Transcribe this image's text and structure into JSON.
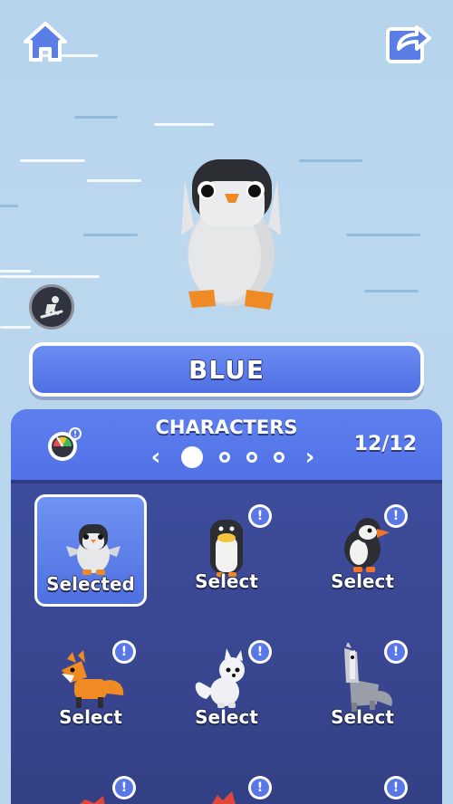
{
  "character_name": "BLUE",
  "panel": {
    "title": "CHARACTERS",
    "counter": "12/12",
    "pager": {
      "prev": "‹",
      "next": "›",
      "pages": 4,
      "active_page": 1
    }
  },
  "characters": [
    {
      "label": "Selected",
      "animal": "baby-penguin",
      "selected": true,
      "new": false
    },
    {
      "label": "Select",
      "animal": "emperor-penguin",
      "selected": false,
      "new": true
    },
    {
      "label": "Select",
      "animal": "puffin",
      "selected": false,
      "new": true
    },
    {
      "label": "Select",
      "animal": "fox",
      "selected": false,
      "new": true
    },
    {
      "label": "Select",
      "animal": "arctic-fox",
      "selected": false,
      "new": true
    },
    {
      "label": "Select",
      "animal": "wolf",
      "selected": false,
      "new": true
    }
  ],
  "icons": {
    "home": "home-icon",
    "share": "share-icon",
    "skate": "skate-icon",
    "gauge": "gauge-icon",
    "new_badge": "!"
  },
  "colors": {
    "accent": "#5172e6",
    "panel": "#3a4792",
    "sky": "#b8d6ee",
    "orange": "#f08a24"
  }
}
